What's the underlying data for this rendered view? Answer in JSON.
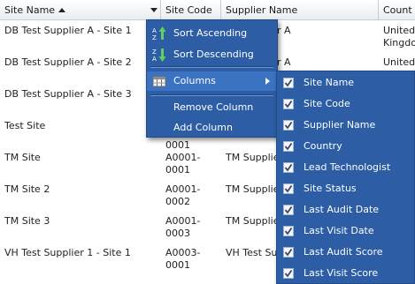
{
  "grid": {
    "columns": [
      {
        "label": "Site Name"
      },
      {
        "label": "Site Code"
      },
      {
        "label": "Supplier Name"
      },
      {
        "label": "Count"
      }
    ],
    "rows": [
      {
        "site_name": "DB Test Supplier A - Site 1",
        "site_code": "",
        "supplier": "",
        "country": "United Kingdom"
      },
      {
        "site_name": "DB Test Supplier A - Site 2",
        "site_code": "",
        "supplier": "",
        "country": "United"
      },
      {
        "site_name": "DB Test Supplier A - Site 3",
        "site_code": "",
        "supplier": "",
        "country": ""
      },
      {
        "site_name": "Test Site",
        "site_code": "0001",
        "supplier": "",
        "country": ""
      },
      {
        "site_name": "TM Site",
        "site_code": "A0001-0001",
        "supplier": "TM Supplier",
        "country": ""
      },
      {
        "site_name": "TM Site 2",
        "site_code": "A0001-0002",
        "supplier": "TM Supplier",
        "country": ""
      },
      {
        "site_name": "TM Site 3",
        "site_code": "A0001-0003",
        "supplier": "TM Supplier",
        "country": ""
      },
      {
        "site_name": "VH Test Supplier 1 - Site 1",
        "site_code": "A0003-0001",
        "supplier": "VH Test Supplier",
        "country": ""
      }
    ],
    "partial_behind_menu": {
      "row0_supplier": "r A",
      "row1_supplier": "r A"
    }
  },
  "menu": {
    "items": [
      {
        "label": "Sort Ascending",
        "icon": "sort-ascending-icon"
      },
      {
        "label": "Sort Descending",
        "icon": "sort-descending-icon"
      },
      {
        "label": "Columns",
        "icon": "columns-icon"
      },
      {
        "label": "Remove Column"
      },
      {
        "label": "Add Column"
      }
    ]
  },
  "columns_submenu": {
    "items": [
      {
        "label": "Site Name",
        "checked": true
      },
      {
        "label": "Site Code",
        "checked": true
      },
      {
        "label": "Supplier Name",
        "checked": true
      },
      {
        "label": "Country",
        "checked": true
      },
      {
        "label": "Lead Technologist",
        "checked": true
      },
      {
        "label": "Site Status",
        "checked": true
      },
      {
        "label": "Last Audit Date",
        "checked": true
      },
      {
        "label": "Last Visit Date",
        "checked": true
      },
      {
        "label": "Last Audit Score",
        "checked": true
      },
      {
        "label": "Last Visit Score",
        "checked": true
      }
    ]
  },
  "colors": {
    "menu_bg": "#2d5da5",
    "menu_hover": "#3b72c2",
    "header_border": "#c5cdd8"
  }
}
